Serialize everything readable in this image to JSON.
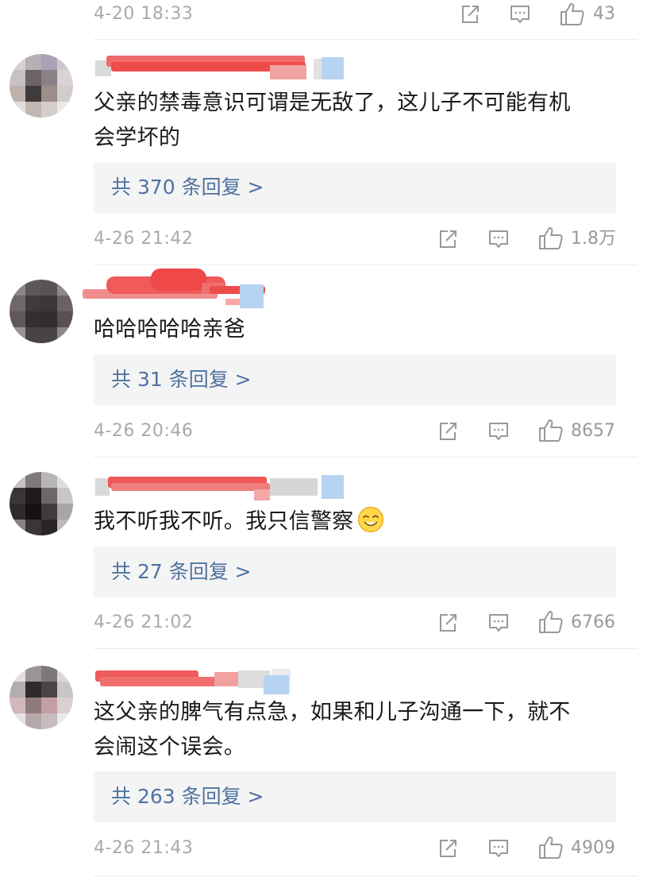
{
  "top_meta": {
    "time": "4-20 18:33",
    "likes": "43"
  },
  "comments": [
    {
      "text_lines": [
        "父亲的禁毒意识可谓是无敌了，这儿子不可能有机",
        "会学坏的"
      ],
      "replies": "共 370 条回复 >",
      "time": "4-26 21:42",
      "likes": "1.8万"
    },
    {
      "text_lines": [
        "哈哈哈哈哈亲爸"
      ],
      "replies": "共 31 条回复 >",
      "time": "4-26 20:46",
      "likes": "8657"
    },
    {
      "text_lines": [
        "我不听我不听。我只信警察"
      ],
      "emoji": "smiling-emoji",
      "replies": "共 27 条回复 >",
      "time": "4-26 21:02",
      "likes": "6766"
    },
    {
      "text_lines": [
        "这父亲的脾气有点急，如果和儿子沟通一下，就不",
        "会闹这个误会。"
      ],
      "replies": "共 263 条回复 >",
      "time": "4-26 21:43",
      "likes": "4909"
    }
  ],
  "icons": {
    "share": "share-icon",
    "comment": "comment-icon",
    "like": "thumbs-up-icon"
  },
  "colors": {
    "reply_link": "#4f72a1",
    "meta": "#aaaaaa",
    "reply_bg": "#f4f4f4",
    "redacted_name": "#ef4b4b",
    "verify_badge": "#b7d3f2"
  }
}
